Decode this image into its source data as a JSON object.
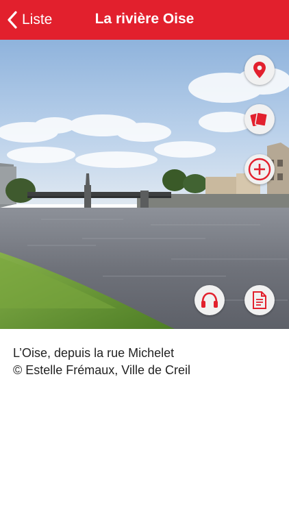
{
  "nav": {
    "back_label": "Liste",
    "title": "La rivière Oise"
  },
  "actions": {
    "map": "map-pin-icon",
    "gallery": "photos-icon",
    "more": "plus-circle-icon",
    "audio": "headphones-icon",
    "text": "document-icon"
  },
  "caption": {
    "line1": "L’Oise, depuis la rue Michelet",
    "line2": "© Estelle Frémaux, Ville de Creil"
  },
  "colors": {
    "accent": "#e2202d",
    "button_bg": "#f1f1f1"
  }
}
